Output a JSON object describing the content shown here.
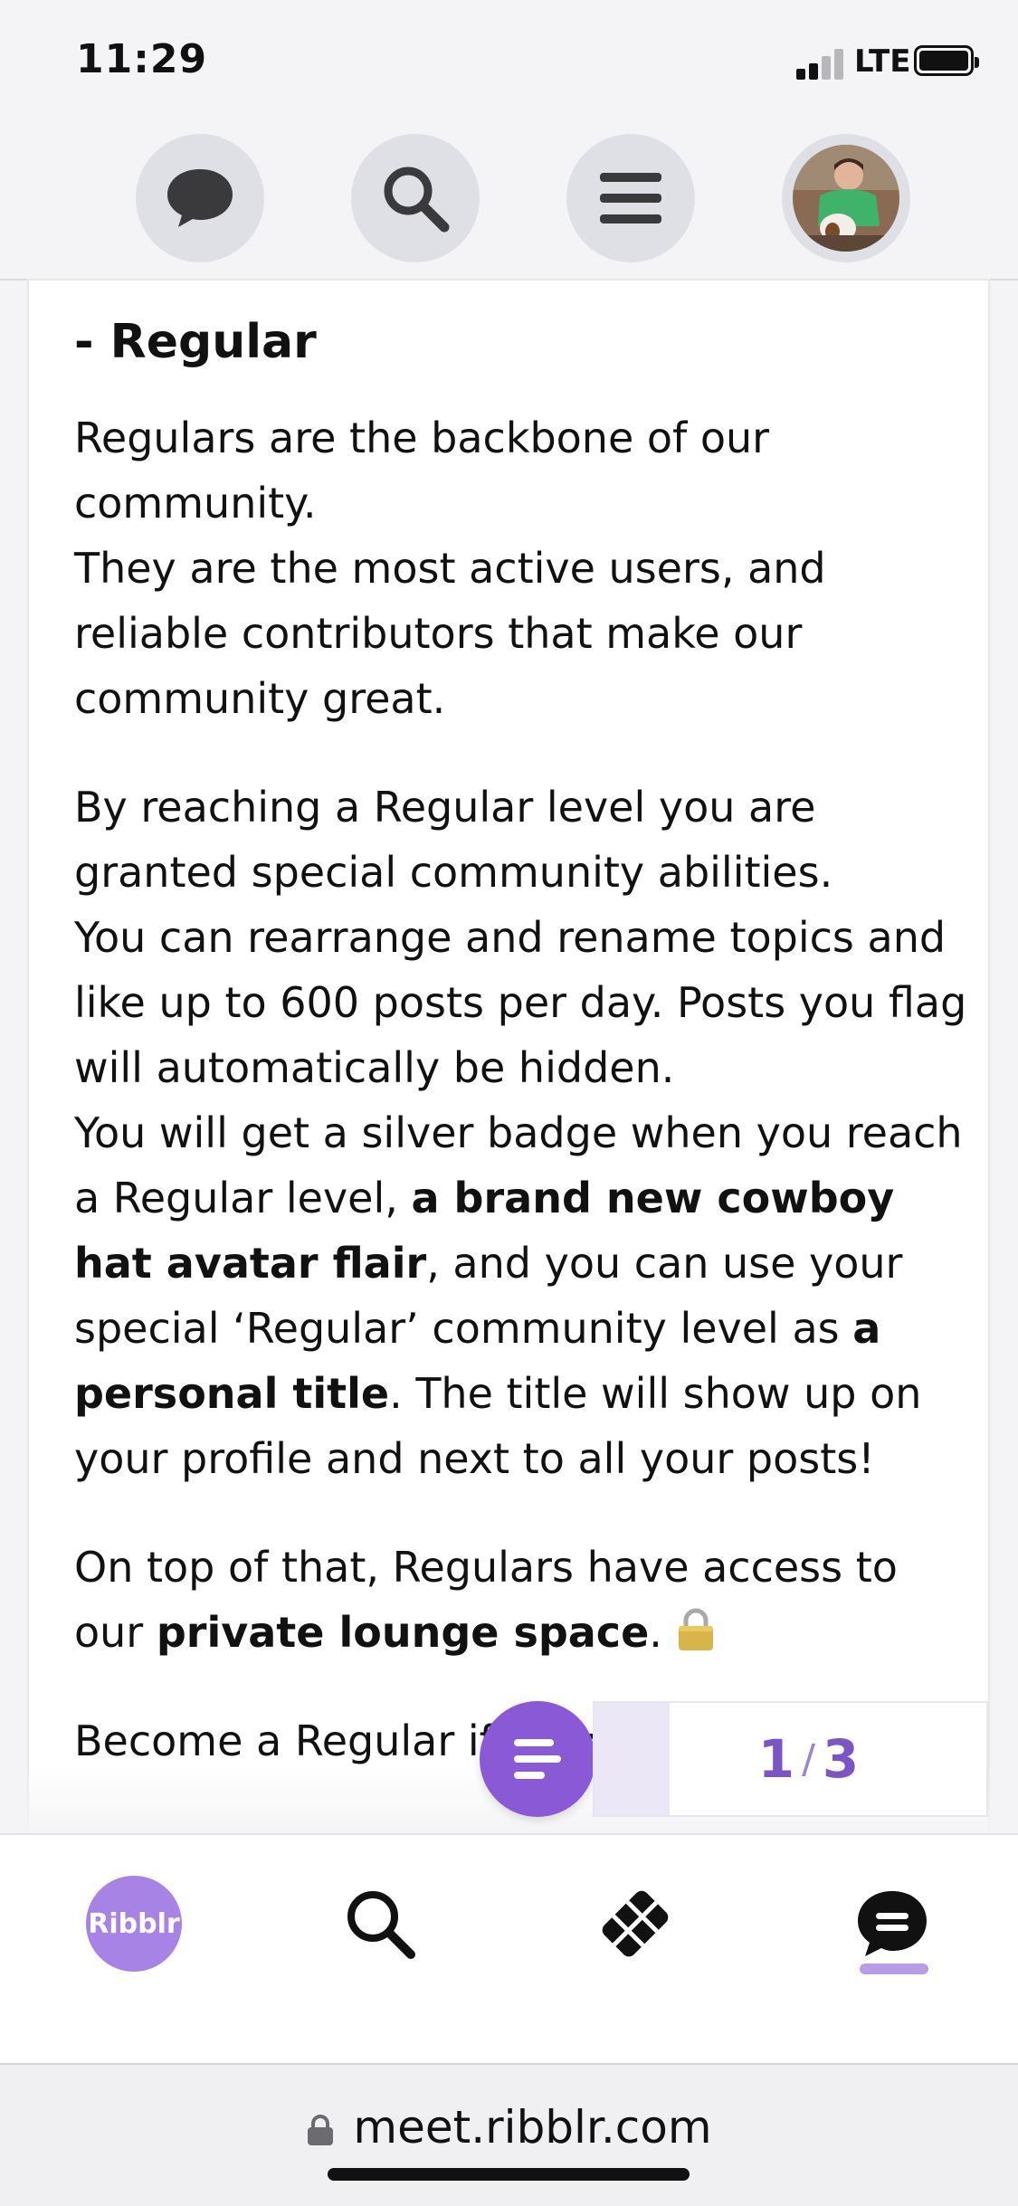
{
  "status_bar": {
    "time": "11:29",
    "network": "LTE"
  },
  "top_nav": {
    "items": [
      {
        "icon": "chat-bubble-icon"
      },
      {
        "icon": "search-icon"
      },
      {
        "icon": "hamburger-menu-icon"
      },
      {
        "icon": "user-avatar"
      }
    ]
  },
  "post": {
    "heading": "- Regular",
    "p1_line1": "Regulars are the backbone of our community.",
    "p1_line2": "They are the most active users, and reliable contributors that make our community great.",
    "p2_line1": "By reaching a Regular level you are granted special community abilities.",
    "p2_line2": "You can rearrange and rename topics and like up to 600 posts per day. Posts you flag will automatically be hidden.",
    "p2_line3_a": "You will get a silver badge when you reach a Regular level, ",
    "p2_line3_b": "a brand new cowboy hat avatar flair",
    "p2_line3_c": ", and you can use your special ‘Regular’ community level as ",
    "p2_line3_d": "a personal title",
    "p2_line3_e": ". The title will show up on your profile and next to all your posts!",
    "p3_a": "On top of that, Regulars have access to our ",
    "p3_b": "private lounge space",
    "p3_c": ".",
    "p4": "Become a Regular if you:"
  },
  "pager": {
    "current": "1",
    "total": "3",
    "progress_fraction": 0.33
  },
  "bottom_nav": {
    "logo_text": "Ribblr",
    "items": [
      "ribblr-logo",
      "search-icon",
      "patterns-icon",
      "chat-icon"
    ],
    "active": "chat-icon"
  },
  "browser": {
    "url": "meet.ribblr.com"
  },
  "colors": {
    "accent": "#8a59d6",
    "accent_light": "#a883e6",
    "pager_text": "#7b55c6"
  }
}
